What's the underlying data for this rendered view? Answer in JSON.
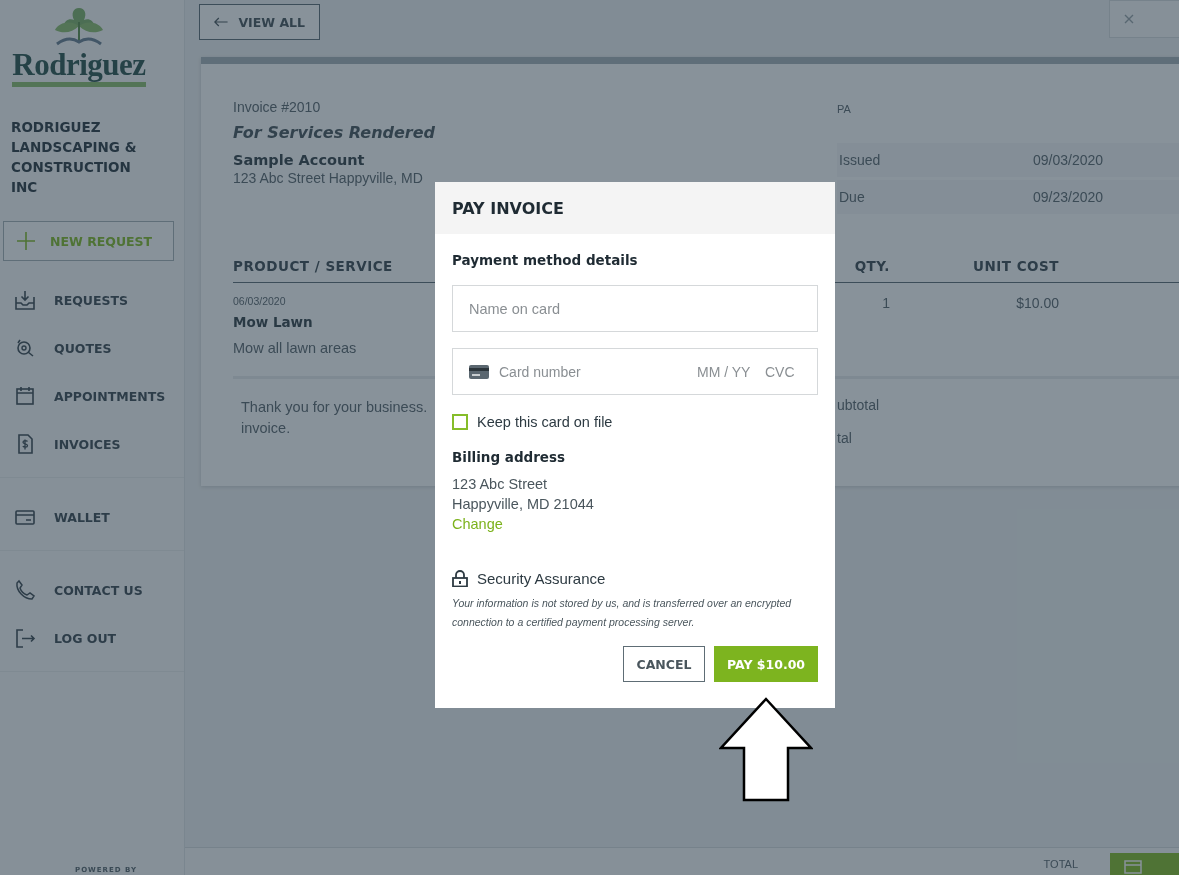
{
  "sidebar": {
    "logo_text": "Rodriguez",
    "company": "RODRIGUEZ LANDSCAPING & CONSTRUCTION INC",
    "new_request": "NEW REQUEST",
    "nav_groups": [
      [
        {
          "label": "REQUESTS"
        },
        {
          "label": "QUOTES"
        },
        {
          "label": "APPOINTMENTS"
        },
        {
          "label": "INVOICES"
        }
      ],
      [
        {
          "label": "WALLET"
        }
      ],
      [
        {
          "label": "CONTACT US"
        },
        {
          "label": "LOG OUT"
        }
      ]
    ],
    "powered_by": "POWERED BY"
  },
  "topbar": {
    "back_button": "VIEW ALL"
  },
  "invoice": {
    "number": "Invoice #2010",
    "status": "PA",
    "subject": "For Services Rendered",
    "account": "Sample Account",
    "address": "123 Abc Street Happyville, MD",
    "dates": [
      {
        "label": "Issued",
        "value": "09/03/2020"
      },
      {
        "label": "Due",
        "value": "09/23/2020"
      }
    ],
    "columns": [
      "PRODUCT / SERVICE",
      "QTY.",
      "UNIT COST"
    ],
    "rows": [
      {
        "date": "06/03/2020",
        "name": "Mow Lawn",
        "description": "Mow all lawn areas",
        "qty": "1",
        "unit_cost": "$10.00"
      }
    ],
    "note_lines": [
      "Thank you for your business.",
      "invoice."
    ],
    "summary": [
      "ubtotal",
      "tal"
    ]
  },
  "footer": {
    "total_label": "TOTAL"
  },
  "modal": {
    "title": "PAY INVOICE",
    "section": "Payment method details",
    "name_field": {
      "placeholder": "Name on card"
    },
    "card_field": {
      "number_placeholder": "Card number",
      "expiry_placeholder": "MM / YY",
      "cvc_placeholder": "CVC"
    },
    "keep_card": {
      "label": "Keep this card on file",
      "checked": false
    },
    "billing": {
      "heading": "Billing address",
      "lines": [
        "123 Abc Street",
        "Happyville, MD 21044"
      ],
      "change_link": "Change"
    },
    "security": {
      "title": "Security Assurance",
      "note": "Your information is not stored by us, and is transferred over an encrypted connection to a certified payment processing server."
    },
    "buttons": [
      {
        "label": "CANCEL",
        "kind": "secondary"
      },
      {
        "label": "PAY $10.00",
        "kind": "primary"
      }
    ]
  }
}
